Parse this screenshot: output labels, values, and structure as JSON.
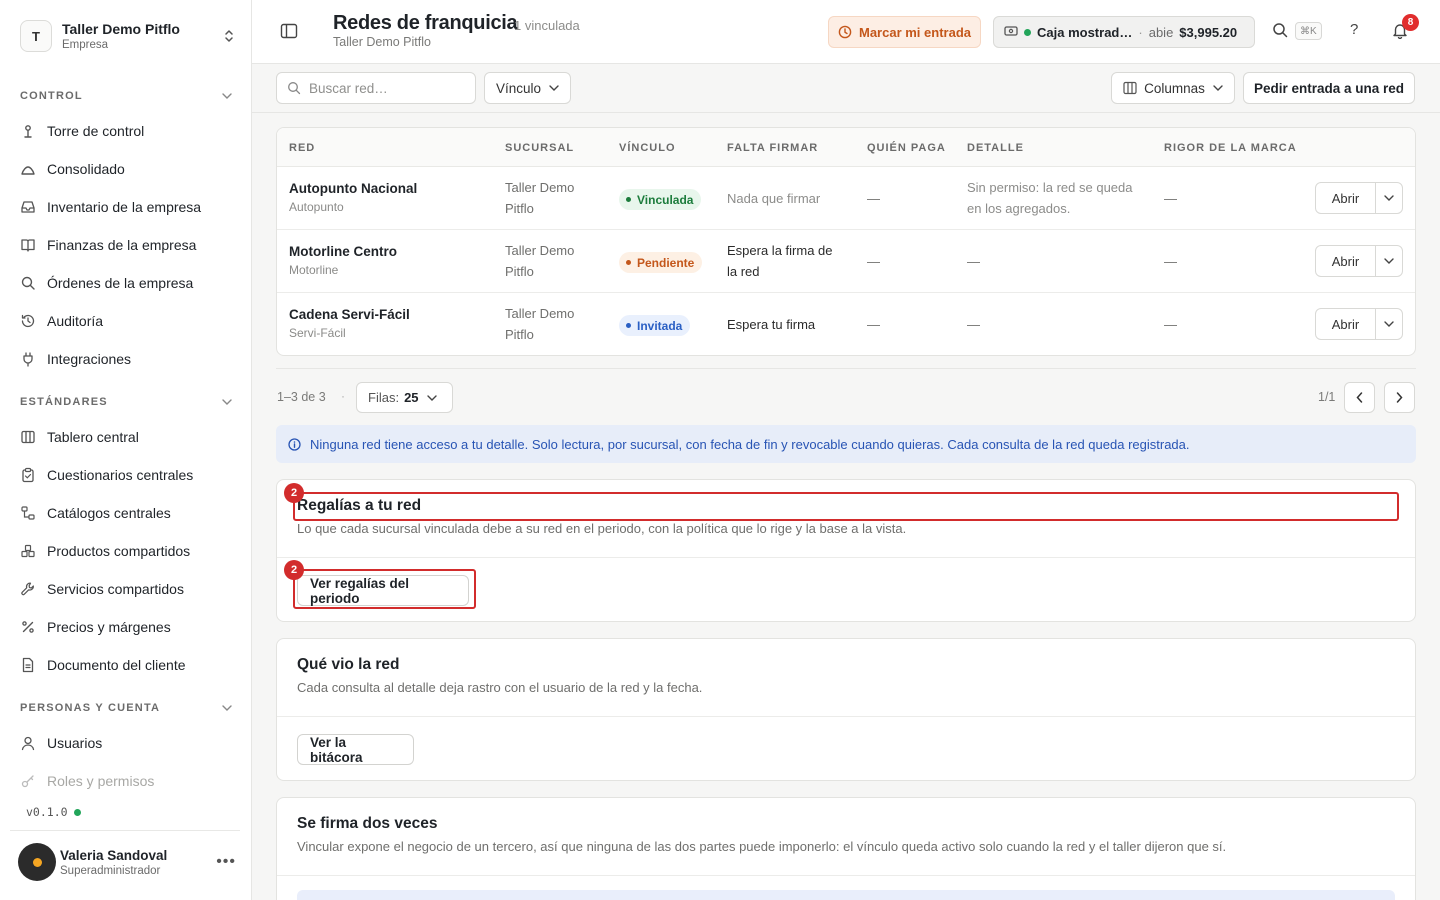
{
  "workspace": {
    "initial": "T",
    "name": "Taller Demo Pitflo",
    "type": "Empresa"
  },
  "sidebar": {
    "sections": [
      {
        "label": "CONTROL"
      },
      {
        "label": "ESTÁNDARES"
      },
      {
        "label": "PERSONAS Y CUENTA"
      }
    ],
    "control_items": [
      {
        "label": "Torre de control",
        "icon": "tower-icon"
      },
      {
        "label": "Consolidado",
        "icon": "chart-icon"
      },
      {
        "label": "Inventario de la empresa",
        "icon": "inbox-icon"
      },
      {
        "label": "Finanzas de la empresa",
        "icon": "book-icon"
      },
      {
        "label": "Órdenes de la empresa",
        "icon": "search-icon"
      },
      {
        "label": "Auditoría",
        "icon": "history-icon"
      },
      {
        "label": "Integraciones",
        "icon": "plug-icon"
      }
    ],
    "standards_items": [
      {
        "label": "Tablero central",
        "icon": "columns-icon"
      },
      {
        "label": "Cuestionarios centrales",
        "icon": "clipboard-icon"
      },
      {
        "label": "Catálogos centrales",
        "icon": "hierarchy-icon"
      },
      {
        "label": "Productos compartidos",
        "icon": "boxes-icon"
      },
      {
        "label": "Servicios compartidos",
        "icon": "wrench-icon"
      },
      {
        "label": "Precios y márgenes",
        "icon": "percent-icon"
      },
      {
        "label": "Documento del cliente",
        "icon": "document-icon"
      }
    ],
    "people_items": [
      {
        "label": "Usuarios",
        "icon": "user-icon"
      },
      {
        "label": "Roles y permisos",
        "icon": "key-icon"
      }
    ],
    "version": "v0.1.0"
  },
  "user": {
    "name": "Valeria Sandoval",
    "role": "Superadministrador"
  },
  "header": {
    "title": "Redes de franquicia",
    "count": "1 vinculada",
    "subtitle": "Taller Demo Pitflo",
    "entry_button": "Marcar mi entrada",
    "register": {
      "name": "Caja mostrad…",
      "sep": "·",
      "state": "abie",
      "amount": "$3,995.20"
    },
    "shortcut": "⌘K",
    "help": "?",
    "notifications": "8"
  },
  "toolbar": {
    "search_placeholder": "Buscar red…",
    "filter_label": "Vínculo",
    "columns_label": "Columnas",
    "request_button": "Pedir entrada a una red"
  },
  "table": {
    "headers": [
      "RED",
      "SUCURSAL",
      "VÍNCULO",
      "FALTA FIRMAR",
      "QUIÉN PAGA",
      "DETALLE",
      "RIGOR DE LA MARCA"
    ],
    "rows": [
      {
        "name": "Autopunto Nacional",
        "brand": "Autopunto",
        "branch1": "Taller Demo",
        "branch2": "Pitflo",
        "status": "Vinculada",
        "status_color": "#1c7c3c",
        "sign1": "Nada que firmar",
        "sign2": "",
        "payer": "—",
        "detail1": "Sin permiso: la red se queda",
        "detail2": "en los agregados.",
        "rigor": "—",
        "action": "Abrir"
      },
      {
        "name": "Motorline Centro",
        "brand": "Motorline",
        "branch1": "Taller Demo",
        "branch2": "Pitflo",
        "status": "Pendiente",
        "status_color": "#c4571b",
        "sign1": "Espera la firma de",
        "sign2": "la red",
        "payer": "—",
        "detail1": "—",
        "detail2": "",
        "rigor": "—",
        "action": "Abrir"
      },
      {
        "name": "Cadena Servi-Fácil",
        "brand": "Servi-Fácil",
        "branch1": "Taller Demo",
        "branch2": "Pitflo",
        "status": "Invitada",
        "status_color": "#2a5fc4",
        "sign1": "Espera tu firma",
        "sign2": "",
        "payer": "—",
        "detail1": "—",
        "detail2": "",
        "rigor": "—",
        "action": "Abrir"
      }
    ]
  },
  "pagination": {
    "range": "1–3 de 3",
    "dot": "·",
    "rows_label": "Filas:",
    "rows_value": "25",
    "pages": "1/1"
  },
  "info_banner": "Ninguna red tiene acceso a tu detalle. Solo lectura, por sucursal, con fecha de fin y revocable cuando quieras. Cada consulta de la red queda registrada.",
  "cards": {
    "royalties": {
      "title": "Regalías a tu red",
      "description": "Lo que cada sucursal vinculada debe a su red en el periodo, con la política que lo rige y la base a la vista.",
      "button": "Ver regalías del periodo",
      "marker": "2"
    },
    "audit": {
      "title": "Qué vio la red",
      "description": "Cada consulta al detalle deja rastro con el usuario de la red y la fecha.",
      "button": "Ver la bitácora"
    },
    "signature": {
      "title": "Se firma dos veces",
      "description": "Vincular expone el negocio de un tercero, así que ninguna de las dos partes puede imponerlo: el vínculo queda activo solo cuando la red y el taller dijeron que sí."
    }
  },
  "colors": {
    "accent_orange": "#c4571b",
    "alert_red": "#d22c2c",
    "info_blue": "#2854b4",
    "online_green": "#22a55a"
  }
}
